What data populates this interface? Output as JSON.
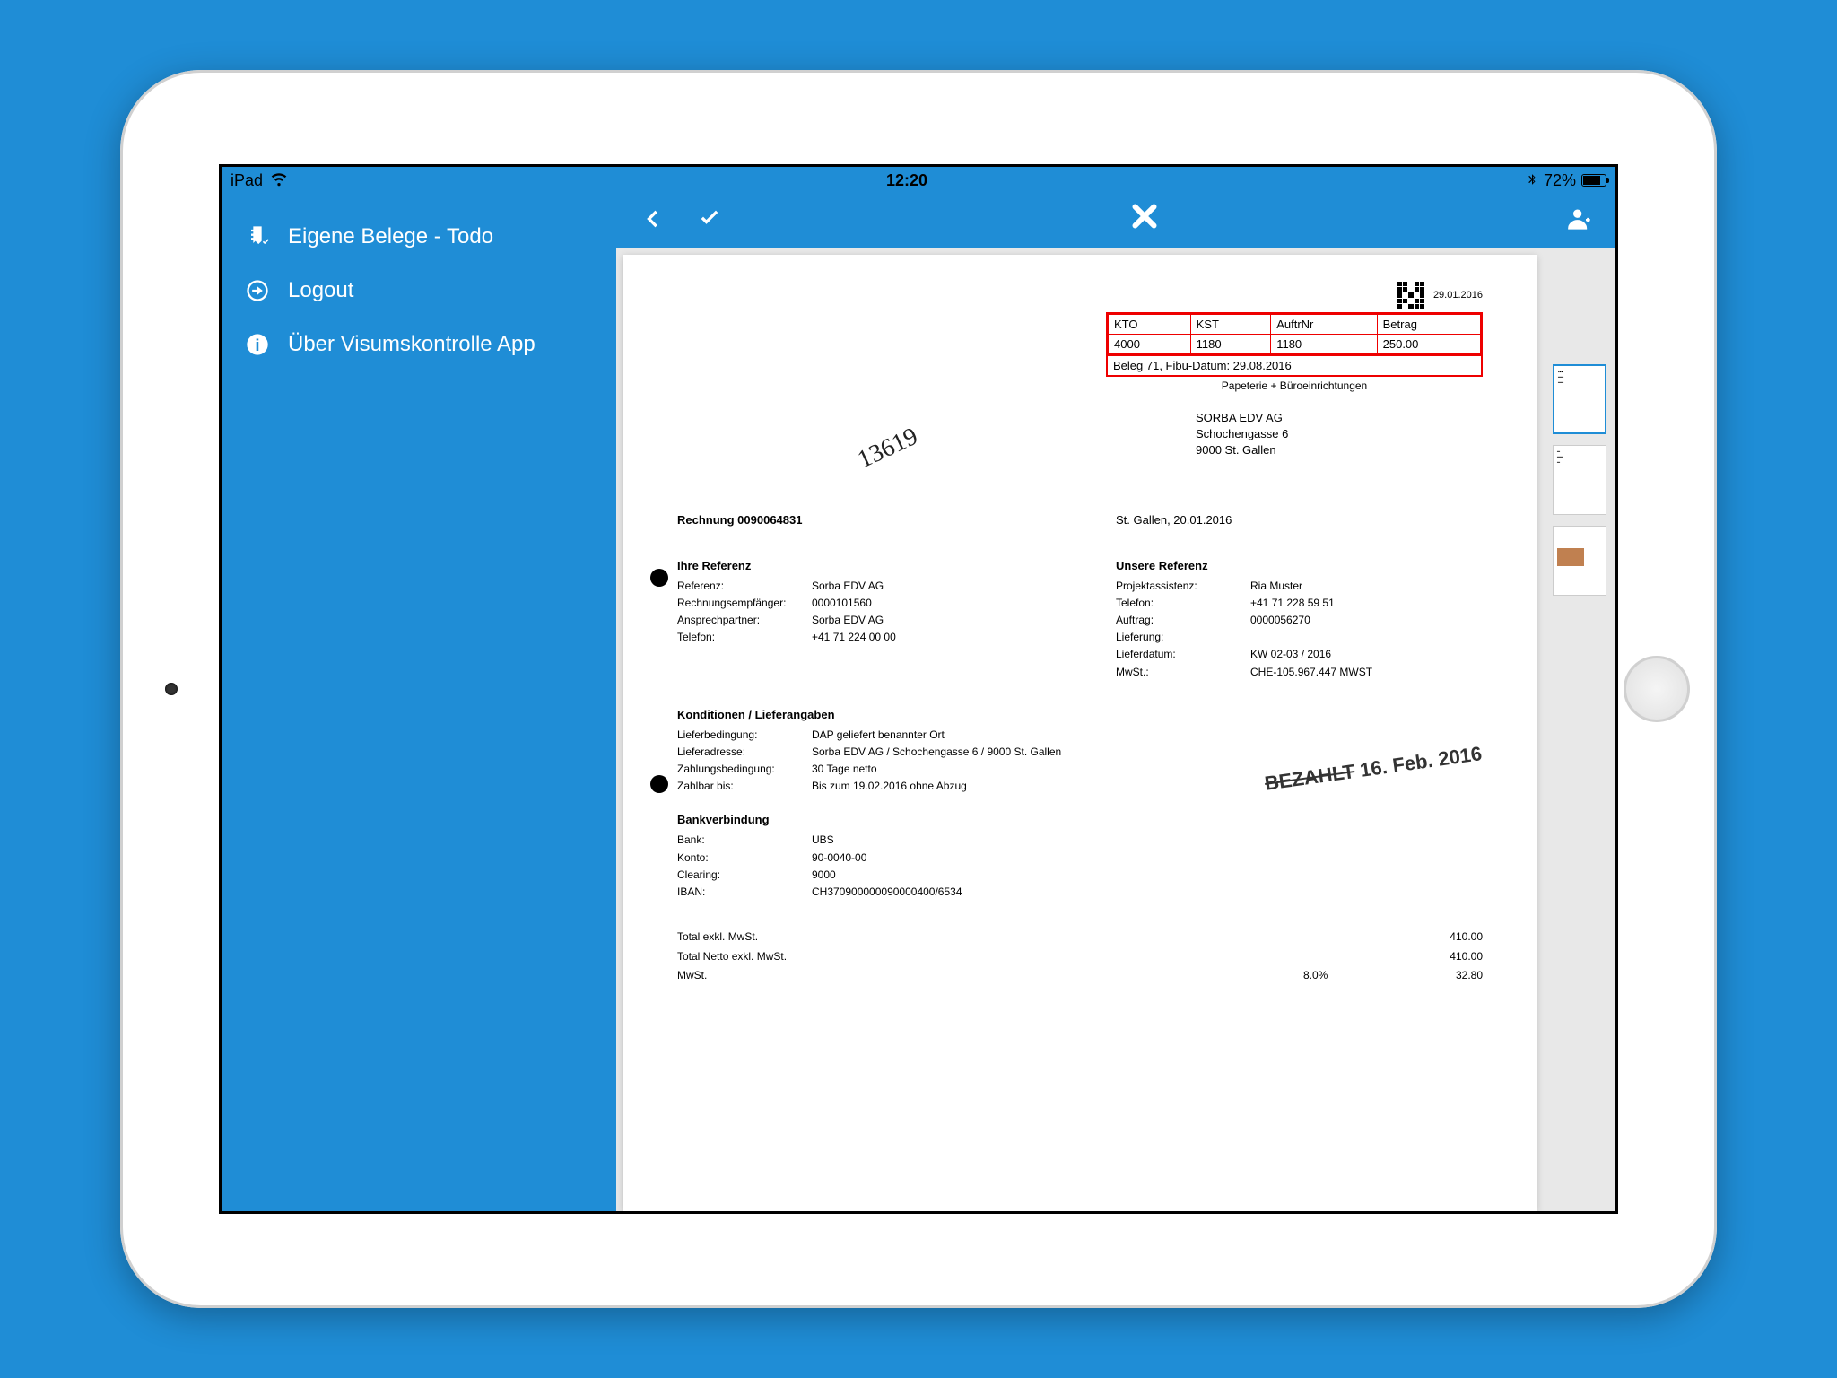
{
  "status": {
    "device": "iPad",
    "time": "12:20",
    "battery": "72%"
  },
  "sidebar": {
    "items": [
      {
        "label": "Eigene Belege - Todo"
      },
      {
        "label": "Logout"
      },
      {
        "label": "Über Visumskontrolle App"
      }
    ]
  },
  "doc": {
    "qr_date": "29.01.2016",
    "redbox": {
      "headers": [
        "KTO",
        "KST",
        "AuftrNr",
        "Betrag"
      ],
      "values": [
        "4000",
        "1180",
        "1180",
        "250.00"
      ],
      "caption": "Beleg 71, Fibu-Datum: 29.08.2016"
    },
    "subline": "Papeterie + Büroeinrichtungen",
    "address": {
      "l1": "SORBA EDV AG",
      "l2": "Schochengasse 6",
      "l3": "9000 St. Gallen"
    },
    "handwritten": "13619",
    "invoice_no_label": "Rechnung 0090064831",
    "invoice_place_date": "St. Gallen, 20.01.2016",
    "ref_left_title": "Ihre Referenz",
    "ref_left": [
      {
        "k": "Referenz:",
        "v": "Sorba EDV AG"
      },
      {
        "k": "Rechnungsempfänger:",
        "v": "0000101560"
      },
      {
        "k": "Ansprechpartner:",
        "v": "Sorba EDV AG"
      },
      {
        "k": "Telefon:",
        "v": "+41 71 224 00 00"
      }
    ],
    "ref_right_title": "Unsere Referenz",
    "ref_right": [
      {
        "k": "Projektassistenz:",
        "v": "Ria Muster"
      },
      {
        "k": "Telefon:",
        "v": "+41 71 228 59 51"
      },
      {
        "k": "Auftrag:",
        "v": "0000056270"
      },
      {
        "k": "Lieferung:",
        "v": ""
      },
      {
        "k": "Lieferdatum:",
        "v": "KW 02-03 / 2016"
      },
      {
        "k": "MwSt.:",
        "v": "CHE-105.967.447 MWST"
      }
    ],
    "cond_title": "Konditionen / Lieferangaben",
    "cond": [
      {
        "k": "Lieferbedingung:",
        "v": "DAP geliefert benannter Ort"
      },
      {
        "k": "Lieferadresse:",
        "v": "Sorba EDV AG / Schochengasse 6 / 9000 St. Gallen"
      },
      {
        "k": "Zahlungsbedingung:",
        "v": "30 Tage netto"
      },
      {
        "k": "Zahlbar bis:",
        "v": "Bis zum 19.02.2016 ohne Abzug"
      }
    ],
    "bank_title": "Bankverbindung",
    "bank": [
      {
        "k": "Bank:",
        "v": "UBS"
      },
      {
        "k": "Konto:",
        "v": "90-0040-00"
      },
      {
        "k": "Clearing:",
        "v": "9000"
      },
      {
        "k": "IBAN:",
        "v": "CH370900000090000400/6534"
      }
    ],
    "stamp": {
      "word": "BEZAHLT",
      "date": "16. Feb. 2016"
    },
    "totals": [
      {
        "l": "Total exkl. MwSt.",
        "m": "",
        "a": "410.00"
      },
      {
        "l": "Total Netto exkl. MwSt.",
        "m": "",
        "a": "410.00"
      },
      {
        "l": "MwSt.",
        "m": "8.0%",
        "a": "32.80"
      }
    ]
  }
}
